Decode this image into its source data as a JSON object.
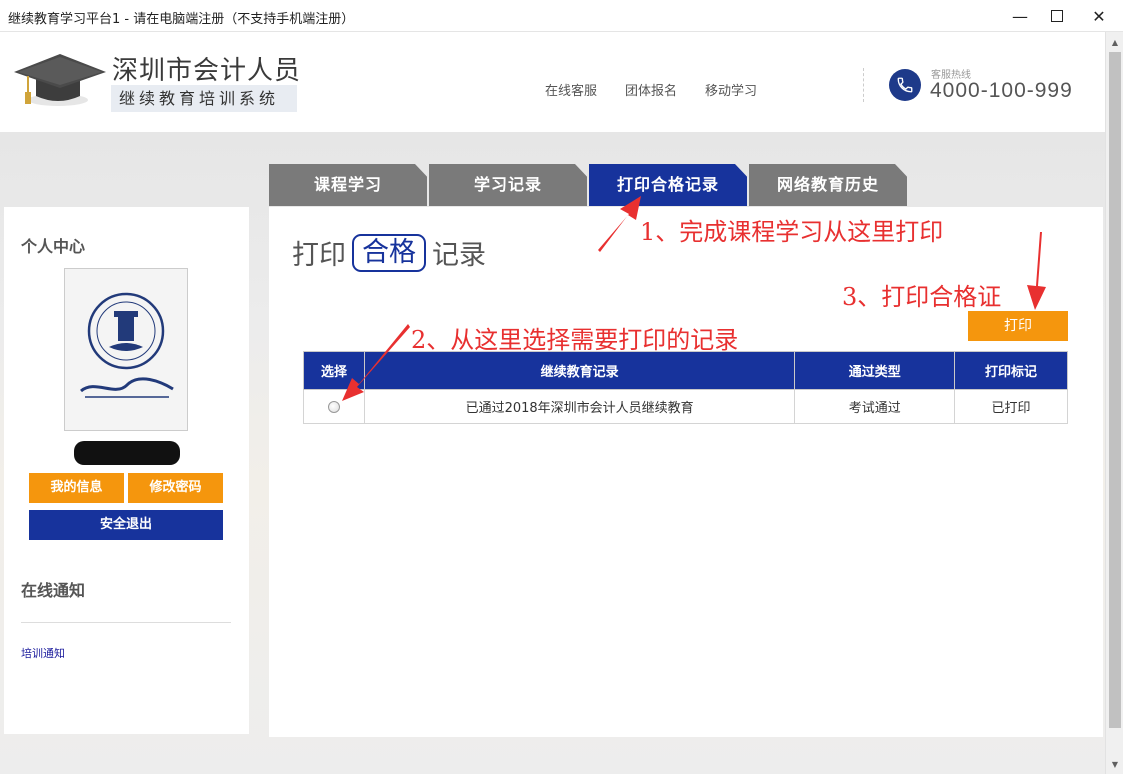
{
  "window": {
    "title": "继续教育学习平台1 - 请在电脑端注册（不支持手机端注册）"
  },
  "header": {
    "brand_main": "深圳市会计人员",
    "brand_sub": "继续教育培训系统",
    "nav": [
      "在线客服",
      "团体报名",
      "移动学习"
    ],
    "hotline_label": "客服热线",
    "hotline_number": "4000-100-999"
  },
  "tabs": [
    {
      "label": "课程学习",
      "active": false
    },
    {
      "label": "学习记录",
      "active": false
    },
    {
      "label": "打印合格记录",
      "active": true
    },
    {
      "label": "网络教育历史",
      "active": false
    }
  ],
  "sidebar": {
    "title": "个人中心",
    "btn_info": "我的信息",
    "btn_password": "修改密码",
    "btn_logout": "安全退出",
    "notice_title": "在线通知",
    "notice_link": "培训通知"
  },
  "main": {
    "title_pre": "打印",
    "title_boxed": "合格",
    "title_post": "记录",
    "print_button": "打印",
    "table": {
      "headers": [
        "选择",
        "继续教育记录",
        "通过类型",
        "打印标记"
      ],
      "rows": [
        {
          "record": "已通过2018年深圳市会计人员继续教育",
          "type": "考试通过",
          "mark": "已打印"
        }
      ]
    }
  },
  "annotations": {
    "step1": "1、完成课程学习从这里打印",
    "step2": "2、从这里选择需要打印的记录",
    "step3": "3、打印合格证"
  },
  "colors": {
    "primary_blue": "#17339c",
    "orange": "#f5960d",
    "tab_gray": "#7a7a7a",
    "annotation_red": "#e83030"
  }
}
